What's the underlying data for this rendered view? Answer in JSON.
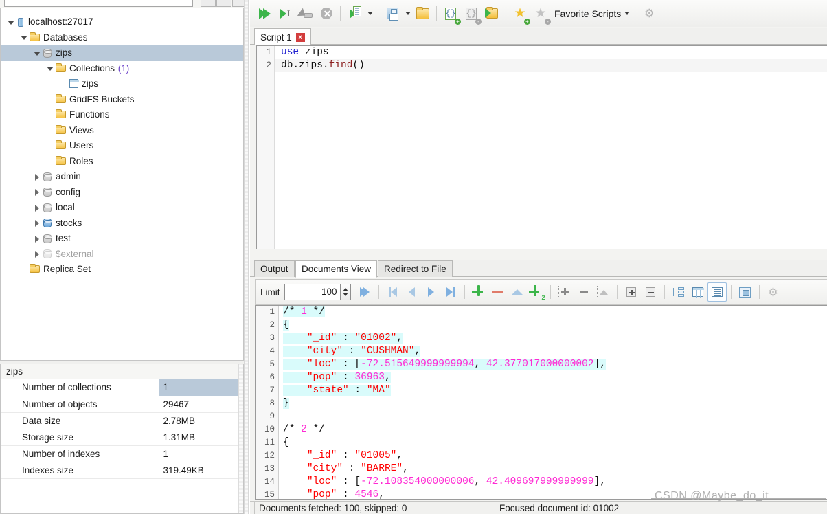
{
  "tree": {
    "nodes": [
      {
        "label": "localhost:27017",
        "indent": 0,
        "arrow": "down",
        "icon": "server-icon",
        "selected": false
      },
      {
        "label": "Databases",
        "indent": 1,
        "arrow": "down",
        "icon": "folder-icon",
        "selected": false
      },
      {
        "label": "zips",
        "indent": 2,
        "arrow": "down",
        "icon": "database-icon",
        "selected": true
      },
      {
        "label": "Collections",
        "suffix": "(1)",
        "indent": 3,
        "arrow": "down",
        "icon": "folder-icon",
        "selected": false
      },
      {
        "label": "zips",
        "indent": 4,
        "arrow": "none",
        "icon": "collection-icon",
        "selected": false
      },
      {
        "label": "GridFS Buckets",
        "indent": 3,
        "arrow": "none",
        "icon": "folder-icon",
        "selected": false
      },
      {
        "label": "Functions",
        "indent": 3,
        "arrow": "none",
        "icon": "folder-icon",
        "selected": false
      },
      {
        "label": "Views",
        "indent": 3,
        "arrow": "none",
        "icon": "folder-icon",
        "selected": false
      },
      {
        "label": "Users",
        "indent": 3,
        "arrow": "none",
        "icon": "folder-icon",
        "selected": false
      },
      {
        "label": "Roles",
        "indent": 3,
        "arrow": "none",
        "icon": "folder-icon",
        "selected": false
      },
      {
        "label": "admin",
        "indent": 2,
        "arrow": "right",
        "icon": "database-icon",
        "selected": false
      },
      {
        "label": "config",
        "indent": 2,
        "arrow": "right",
        "icon": "database-icon",
        "selected": false
      },
      {
        "label": "local",
        "indent": 2,
        "arrow": "right",
        "icon": "database-icon",
        "selected": false
      },
      {
        "label": "stocks",
        "indent": 2,
        "arrow": "right",
        "icon": "database-icon-blue",
        "selected": false
      },
      {
        "label": "test",
        "indent": 2,
        "arrow": "right",
        "icon": "database-icon",
        "selected": false
      },
      {
        "label": "$external",
        "indent": 2,
        "arrow": "right",
        "icon": "database-icon-grey",
        "dim": true,
        "selected": false
      },
      {
        "label": "Replica Set",
        "indent": 1,
        "arrow": "none",
        "icon": "folder-icon",
        "selected": false
      }
    ]
  },
  "info_panel": {
    "title": "zips",
    "rows": [
      {
        "key": "Number of collections",
        "value": "1"
      },
      {
        "key": "Number of objects",
        "value": "29467"
      },
      {
        "key": "Data size",
        "value": "2.78MB"
      },
      {
        "key": "Storage size",
        "value": "1.31MB"
      },
      {
        "key": "Number of indexes",
        "value": "1"
      },
      {
        "key": "Indexes size",
        "value": "319.49KB"
      }
    ]
  },
  "toolbar": {
    "execute_all": "execute-all-icon",
    "execute_one": "execute-one-icon",
    "execute_stop_label": "stop-icon",
    "stop_all": "stop-all-icon",
    "execute_script_dropdown": "execute-script-dropdown-icon",
    "save": "save-icon",
    "open": "open-folder-icon",
    "new_shell": "new-shell-icon",
    "duplicate_shell": "duplicate-shell-icon",
    "open_shell": "open-shell-icon",
    "add_favorite": "add-favorite-icon",
    "remove_favorite": "remove-favorite-icon",
    "favorite_scripts_label": "Favorite Scripts",
    "settings": "gear-icon"
  },
  "script_tabs": [
    {
      "label": "Script 1",
      "active": true,
      "close": "x"
    }
  ],
  "editor": {
    "lines": [
      {
        "num": "1",
        "tokens": [
          {
            "t": "use",
            "c": "kw"
          },
          {
            "t": " zips",
            "c": "plain"
          }
        ],
        "current": false
      },
      {
        "num": "2",
        "tokens": [
          {
            "t": "db.zips.",
            "c": "plain"
          },
          {
            "t": "find",
            "c": "fn"
          },
          {
            "t": "()",
            "c": "plain"
          }
        ],
        "current": true,
        "caret": true
      }
    ]
  },
  "result_tabs": [
    {
      "label": "Output",
      "active": false
    },
    {
      "label": "Documents View",
      "active": true
    },
    {
      "label": "Redirect to File",
      "active": false
    }
  ],
  "result_toolbar": {
    "limit_label": "Limit",
    "limit_value": "100",
    "buttons": [
      "run-to-end-icon",
      "first-page-icon",
      "prev-page-icon",
      "next-page-icon",
      "last-page-icon",
      "insert-document-icon",
      "delete-document-icon",
      "revert-icon",
      "copy-document-icon",
      "add-field-icon",
      "remove-field-icon",
      "edit-field-icon",
      "expand-all-icon",
      "collapse-all-icon",
      "tree-view-icon",
      "table-view-icon",
      "json-view-icon",
      "split-view-icon",
      "view-settings-icon"
    ]
  },
  "documents": {
    "lines": [
      {
        "num": "1",
        "hl": true,
        "tokens": [
          {
            "t": "/* ",
            "c": "j-com"
          },
          {
            "t": "1",
            "c": "j-comnum"
          },
          {
            "t": " */",
            "c": "j-com"
          }
        ]
      },
      {
        "num": "2",
        "hl": true,
        "tokens": [
          {
            "t": "{",
            "c": "j-punct"
          }
        ]
      },
      {
        "num": "3",
        "hl": true,
        "tokens": [
          {
            "t": "    ",
            "c": "j-punct"
          },
          {
            "t": "\"_id\"",
            "c": "j-str"
          },
          {
            "t": " : ",
            "c": "j-punct"
          },
          {
            "t": "\"01002\"",
            "c": "j-str"
          },
          {
            "t": ",",
            "c": "j-punct"
          }
        ]
      },
      {
        "num": "4",
        "hl": true,
        "tokens": [
          {
            "t": "    ",
            "c": "j-punct"
          },
          {
            "t": "\"city\"",
            "c": "j-str"
          },
          {
            "t": " : ",
            "c": "j-punct"
          },
          {
            "t": "\"CUSHMAN\"",
            "c": "j-str"
          },
          {
            "t": ",",
            "c": "j-punct"
          }
        ]
      },
      {
        "num": "5",
        "hl": true,
        "tokens": [
          {
            "t": "    ",
            "c": "j-punct"
          },
          {
            "t": "\"loc\"",
            "c": "j-str"
          },
          {
            "t": " : [",
            "c": "j-punct"
          },
          {
            "t": "-72.515649999999994",
            "c": "j-num"
          },
          {
            "t": ", ",
            "c": "j-punct"
          },
          {
            "t": "42.377017000000002",
            "c": "j-num"
          },
          {
            "t": "],",
            "c": "j-punct"
          }
        ]
      },
      {
        "num": "6",
        "hl": true,
        "tokens": [
          {
            "t": "    ",
            "c": "j-punct"
          },
          {
            "t": "\"pop\"",
            "c": "j-str"
          },
          {
            "t": " : ",
            "c": "j-punct"
          },
          {
            "t": "36963",
            "c": "j-num"
          },
          {
            "t": ",",
            "c": "j-punct"
          }
        ]
      },
      {
        "num": "7",
        "hl": true,
        "tokens": [
          {
            "t": "    ",
            "c": "j-punct"
          },
          {
            "t": "\"state\"",
            "c": "j-str"
          },
          {
            "t": " : ",
            "c": "j-punct"
          },
          {
            "t": "\"MA\"",
            "c": "j-str"
          }
        ]
      },
      {
        "num": "8",
        "hl": true,
        "tokens": [
          {
            "t": "}",
            "c": "j-punct"
          }
        ]
      },
      {
        "num": "9",
        "hl": false,
        "tokens": [
          {
            "t": "",
            "c": "j-punct"
          }
        ]
      },
      {
        "num": "10",
        "hl": false,
        "tokens": [
          {
            "t": "/* ",
            "c": "j-com"
          },
          {
            "t": "2",
            "c": "j-comnum"
          },
          {
            "t": " */",
            "c": "j-com"
          }
        ]
      },
      {
        "num": "11",
        "hl": false,
        "tokens": [
          {
            "t": "{",
            "c": "j-punct"
          }
        ]
      },
      {
        "num": "12",
        "hl": false,
        "tokens": [
          {
            "t": "    ",
            "c": "j-punct"
          },
          {
            "t": "\"_id\"",
            "c": "j-str"
          },
          {
            "t": " : ",
            "c": "j-punct"
          },
          {
            "t": "\"01005\"",
            "c": "j-str"
          },
          {
            "t": ",",
            "c": "j-punct"
          }
        ]
      },
      {
        "num": "13",
        "hl": false,
        "tokens": [
          {
            "t": "    ",
            "c": "j-punct"
          },
          {
            "t": "\"city\"",
            "c": "j-str"
          },
          {
            "t": " : ",
            "c": "j-punct"
          },
          {
            "t": "\"BARRE\"",
            "c": "j-str"
          },
          {
            "t": ",",
            "c": "j-punct"
          }
        ]
      },
      {
        "num": "14",
        "hl": false,
        "tokens": [
          {
            "t": "    ",
            "c": "j-punct"
          },
          {
            "t": "\"loc\"",
            "c": "j-str"
          },
          {
            "t": " : [",
            "c": "j-punct"
          },
          {
            "t": "-72.108354000000006",
            "c": "j-num"
          },
          {
            "t": ", ",
            "c": "j-punct"
          },
          {
            "t": "42.409697999999999",
            "c": "j-num"
          },
          {
            "t": "],",
            "c": "j-punct"
          }
        ]
      },
      {
        "num": "15",
        "hl": false,
        "tokens": [
          {
            "t": "    ",
            "c": "j-punct"
          },
          {
            "t": "\"pop\"",
            "c": "j-str"
          },
          {
            "t": " : ",
            "c": "j-punct"
          },
          {
            "t": "4546",
            "c": "j-num"
          },
          {
            "t": ",",
            "c": "j-punct"
          }
        ]
      }
    ]
  },
  "statusbar": {
    "fetched": "Documents fetched: 100, skipped: 0",
    "focused": "Focused document id: 01002"
  },
  "watermark": "CSDN @Maybe_do_it"
}
